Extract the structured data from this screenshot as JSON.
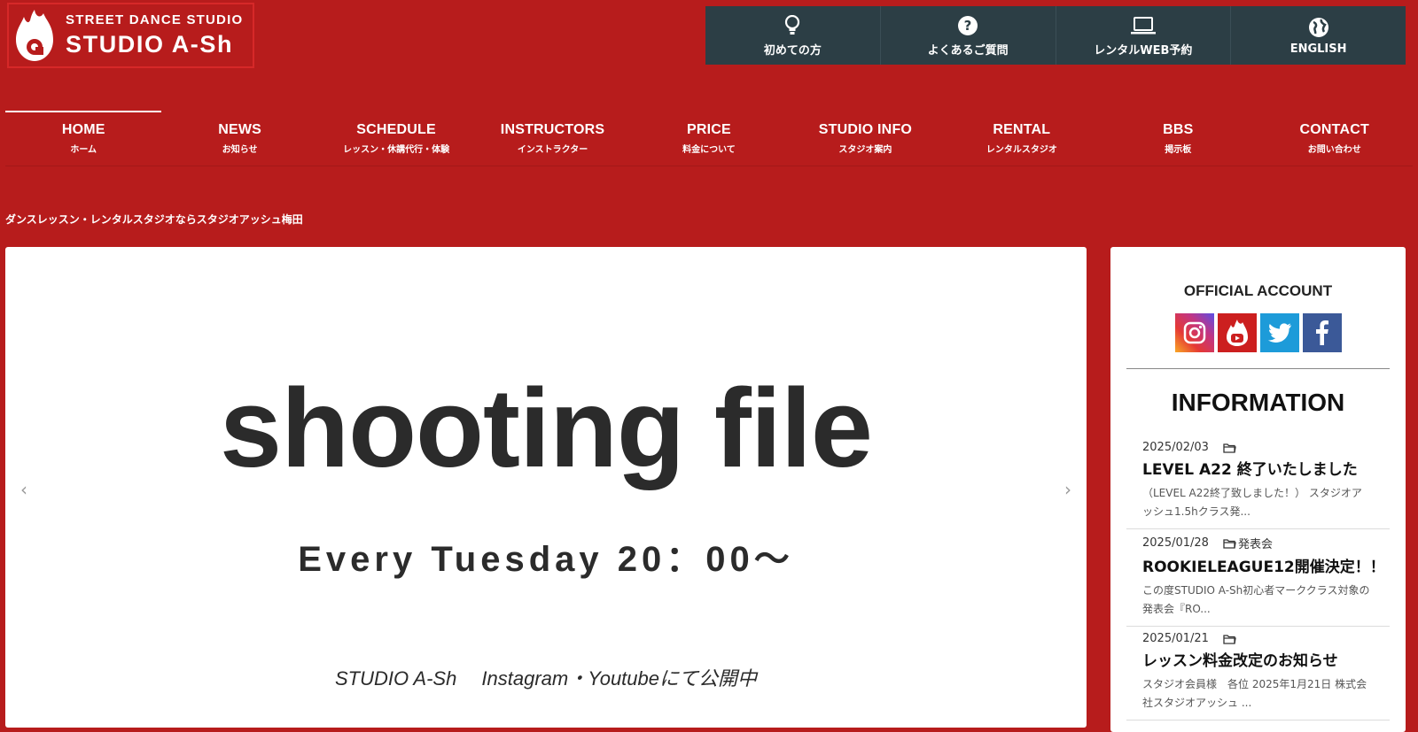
{
  "logo": {
    "sub": "STREET DANCE STUDIO",
    "main": "STUDIO A-Sh"
  },
  "util_nav": [
    {
      "icon": "lightbulb-icon",
      "label": "初めての方"
    },
    {
      "icon": "question-icon",
      "label": "よくあるご質問"
    },
    {
      "icon": "laptop-icon",
      "label": "レンタルWEB予約"
    },
    {
      "icon": "globe-icon",
      "label": "ENGLISH"
    }
  ],
  "main_nav": [
    {
      "en": "HOME",
      "ja": "ホーム",
      "active": true
    },
    {
      "en": "NEWS",
      "ja": "お知らせ"
    },
    {
      "en": "SCHEDULE",
      "ja": "レッスン・休講代行・体験"
    },
    {
      "en": "INSTRUCTORS",
      "ja": "インストラクター"
    },
    {
      "en": "PRICE",
      "ja": "料金について"
    },
    {
      "en": "STUDIO INFO",
      "ja": "スタジオ案内"
    },
    {
      "en": "RENTAL",
      "ja": "レンタルスタジオ"
    },
    {
      "en": "BBS",
      "ja": "掲示板"
    },
    {
      "en": "CONTACT",
      "ja": "お問い合わせ"
    }
  ],
  "tagline": "ダンスレッスン・レンタルスタジオならスタジオアッシュ梅田",
  "slider": {
    "title": "shooting file",
    "subtitle": "Every Tuesday 20：00～",
    "footer": "STUDIO A-Sh　 Instagram・Youtubeにて公開中",
    "prev": "‹",
    "next": "›"
  },
  "sidebar": {
    "official_title": "OFFICIAL ACCOUNT",
    "social": [
      {
        "icon": "instagram-icon"
      },
      {
        "icon": "youtube-icon"
      },
      {
        "icon": "twitter-icon"
      },
      {
        "icon": "facebook-icon"
      }
    ],
    "info_title": "INFORMATION",
    "posts": [
      {
        "date": "2025/02/03",
        "category": "",
        "title": "LEVEL A22 終了いたしました",
        "excerpt": "（LEVEL A22終了致しました！） スタジオアッシュ1.5hクラス発..."
      },
      {
        "date": "2025/01/28",
        "category": "発表会",
        "title": "ROOKIELEAGUE12開催決定！！",
        "excerpt": "この度STUDIO A-Sh初心者マーククラス対象の発表会『RO..."
      },
      {
        "date": "2025/01/21",
        "category": "",
        "title": "レッスン料金改定のお知らせ",
        "excerpt": "スタジオ会員様　各位 2025年1月21日 株式会社スタジオアッシュ ..."
      }
    ]
  },
  "colors": {
    "brand_red": "#b71c1c",
    "util_bg": "#2c3e45",
    "instagram": "#c13584",
    "youtube": "#cc1f1f",
    "twitter": "#1da1f2",
    "facebook": "#3b5998"
  }
}
